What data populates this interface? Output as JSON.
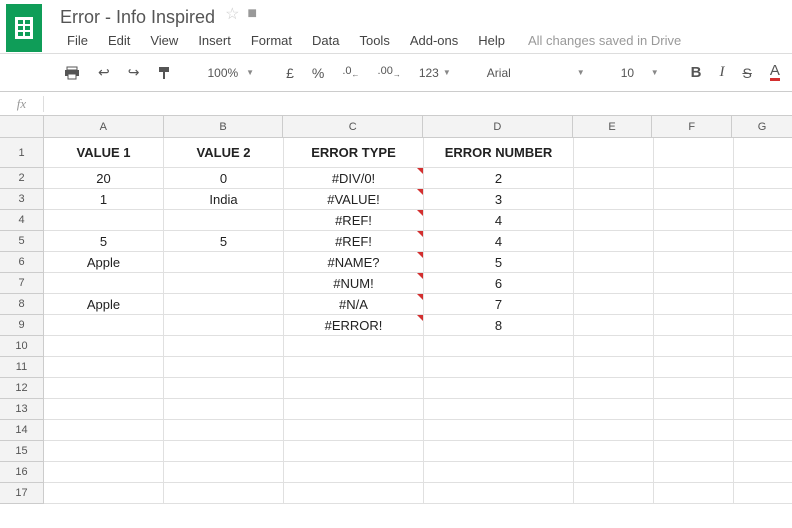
{
  "doc": {
    "title": "Error - Info Inspired"
  },
  "menu": {
    "file": "File",
    "edit": "Edit",
    "view": "View",
    "insert": "Insert",
    "format": "Format",
    "data": "Data",
    "tools": "Tools",
    "addons": "Add-ons",
    "help": "Help",
    "save_status": "All changes saved in Drive"
  },
  "toolbar": {
    "zoom": "100%",
    "currency": "£",
    "percent": "%",
    "dec_less": ".0",
    "dec_more": ".00",
    "more_formats": "123",
    "font": "Arial",
    "size": "10",
    "bold": "B",
    "italic": "I",
    "strike": "S",
    "text_color": "A"
  },
  "fx": {
    "label": "fx",
    "value": ""
  },
  "columns": [
    "A",
    "B",
    "C",
    "D",
    "E",
    "F",
    "G"
  ],
  "row_count": 17,
  "headers": {
    "A": "VALUE 1",
    "B": "VALUE 2",
    "C": "ERROR TYPE",
    "D": "ERROR NUMBER"
  },
  "rows": [
    {
      "A": "20",
      "B": "0",
      "C": "#DIV/0!",
      "D": "2"
    },
    {
      "A": "1",
      "B": "India",
      "C": "#VALUE!",
      "D": "3"
    },
    {
      "A": "",
      "B": "",
      "C": "#REF!",
      "D": "4"
    },
    {
      "A": "5",
      "B": "5",
      "C": "#REF!",
      "D": "4"
    },
    {
      "A": "Apple",
      "B": "",
      "C": "#NAME?",
      "D": "5"
    },
    {
      "A": "",
      "B": "",
      "C": "#NUM!",
      "D": "6"
    },
    {
      "A": "Apple",
      "B": "",
      "C": "#N/A",
      "D": "7"
    },
    {
      "A": "",
      "B": "",
      "C": "#ERROR!",
      "D": "8"
    }
  ]
}
